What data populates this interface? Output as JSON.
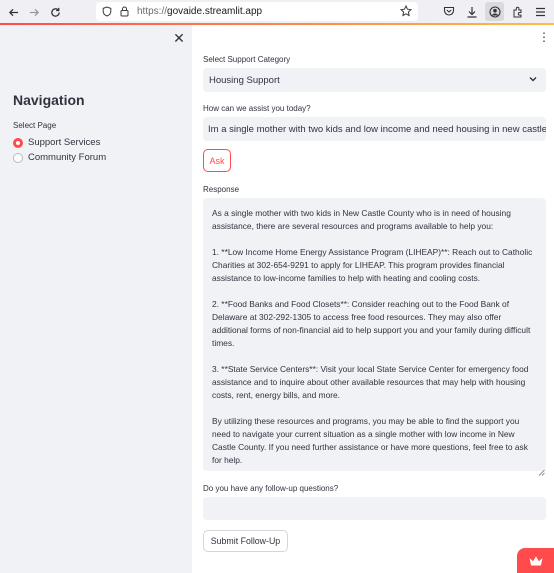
{
  "browser": {
    "url_scheme": "https://",
    "url_host": "govaide.streamlit.app"
  },
  "sidebar": {
    "close_glyph": "✕",
    "title": "Navigation",
    "select_label": "Select Page",
    "options": [
      {
        "label": "Support Services",
        "selected": true
      },
      {
        "label": "Community Forum",
        "selected": false
      }
    ]
  },
  "main": {
    "menu_glyph": "⋮",
    "category_label": "Select Support Category",
    "category_value": "Housing Support",
    "question_label": "How can we assist you today?",
    "question_value": "Im a single mother with two kids and low income and need housing in new castle coun",
    "ask_label": "Ask",
    "response_label": "Response",
    "response_paragraphs": [
      "As a single mother with two kids in New Castle County who is in need of housing assistance, there are several resources and programs available to help you:",
      "1. **Low Income Home Energy Assistance Program (LIHEAP)**: Reach out to Catholic Charities at 302-654-9291 to apply for LIHEAP. This program provides financial assistance to low-income families to help with heating and cooling costs.",
      "2. **Food Banks and Food Closets**: Consider reaching out to the Food Bank of Delaware at 302-292-1305 to access free food resources. They may also offer additional forms of non-financial aid to help support you and your family during difficult times.",
      "3. **State Service Centers**: Visit your local State Service Center for emergency food assistance and to inquire about other available resources that may help with housing costs, rent, energy bills, and more.",
      "By utilizing these resources and programs, you may be able to find the support you need to navigate your current situation as a single mother with low income in New Castle County. If you need further assistance or have more questions, feel free to ask for help."
    ],
    "followup_label": "Do you have any follow-up questions?",
    "followup_value": "",
    "submit_label": "Submit Follow-Up"
  },
  "colors": {
    "accent": "#ff4b4b",
    "sidebar_bg": "#f0f2f6",
    "text": "#31333f"
  }
}
